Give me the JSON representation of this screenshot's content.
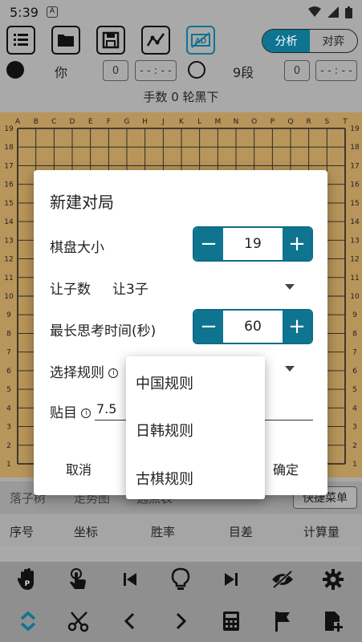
{
  "status": {
    "time": "5:39",
    "notif": "A"
  },
  "toolbar": {
    "icons": [
      "list-icon",
      "folder-icon",
      "save-icon",
      "analysis-chart-icon",
      "ad-block-icon"
    ],
    "seg": [
      "分析",
      "对弈"
    ]
  },
  "players": {
    "black_name": "你",
    "black_captures": "0",
    "black_time": "- - : - -",
    "white_name": "9段",
    "white_captures": "0",
    "white_time": "- - : - -"
  },
  "move_status": "手数 0  轮黑下",
  "board": {
    "cols": [
      "A",
      "B",
      "C",
      "D",
      "E",
      "F",
      "G",
      "H",
      "J",
      "K",
      "L",
      "M",
      "N",
      "O",
      "P",
      "Q",
      "R",
      "S",
      "T"
    ],
    "rows": [
      "19",
      "18",
      "17",
      "16",
      "15",
      "14",
      "13",
      "12",
      "11",
      "10",
      "9",
      "8",
      "7",
      "6",
      "5",
      "4",
      "3",
      "2",
      "1"
    ]
  },
  "dialog": {
    "title": "新建对局",
    "board_size_label": "棋盘大小",
    "board_size_value": "19",
    "handicap_label": "让子数",
    "handicap_value": "让3子",
    "think_time_label": "最长思考时间(秒)",
    "think_time_value": "60",
    "rules_label": "选择规则",
    "komi_label": "贴目",
    "komi_value": "7.5",
    "cancel": "取消",
    "ok": "确定",
    "minus": "−",
    "plus": "+",
    "info": "i"
  },
  "rules_menu": [
    "中国规则",
    "日韩规则",
    "古棋规则"
  ],
  "tabs": {
    "t1": "落子树",
    "t2": "走势图",
    "t3": "选点表",
    "quick": "快捷菜单"
  },
  "table_header": [
    "序号",
    "坐标",
    "胜率",
    "目差",
    "计算量"
  ],
  "bottom_icons_row1": [
    "hand-pass-icon",
    "touch-icon",
    "skip-start-icon",
    "lightbulb-icon",
    "skip-end-icon",
    "eye-off-icon",
    "gear-icon"
  ],
  "bottom_icons_row2": [
    "expand-collapse-icon",
    "scissors-icon",
    "chevron-left-icon",
    "chevron-right-icon",
    "calculator-icon",
    "flag-icon",
    "add-file-icon"
  ]
}
